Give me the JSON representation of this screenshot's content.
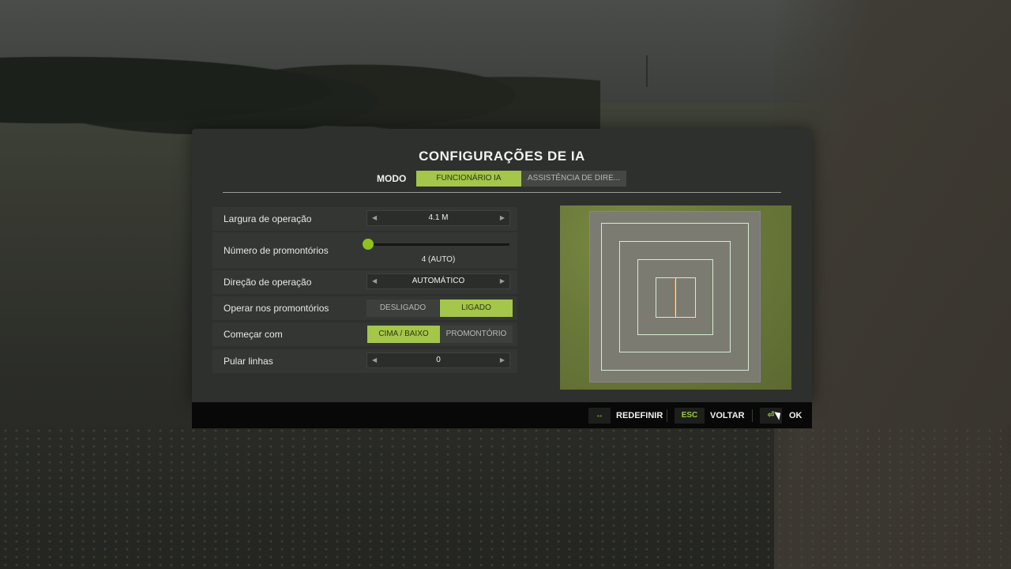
{
  "dialog": {
    "title": "CONFIGURAÇÕES DE IA",
    "mode_label": "MODO",
    "mode_tabs": [
      {
        "label": "FUNCIONÁRIO IA",
        "active": true
      },
      {
        "label": "ASSISTÊNCIA DE DIRE...",
        "active": false
      }
    ]
  },
  "settings": {
    "working_width": {
      "label": "Largura de operação",
      "value": "4.1 M"
    },
    "headlands": {
      "label": "Número de promontórios",
      "value": "4 (AUTO)"
    },
    "direction": {
      "label": "Direção de operação",
      "value": "AUTOMÁTICO"
    },
    "work_headlands": {
      "label": "Operar nos promontórios",
      "options": [
        "DESLIGADO",
        "LIGADO"
      ],
      "selected": "LIGADO"
    },
    "start_with": {
      "label": "Começar com",
      "options": [
        "CIMA / BAIXO",
        "PROMONTÓRIO"
      ],
      "selected": "CIMA / BAIXO"
    },
    "skip_lines": {
      "label": "Pular linhas",
      "value": "0"
    }
  },
  "footer": {
    "reset": {
      "key_icon": "reset-arrows-icon",
      "label": "REDEFINIR"
    },
    "back": {
      "key": "ESC",
      "label": "VOLTAR"
    },
    "ok": {
      "key_icon": "enter-icon",
      "label": "OK"
    }
  },
  "colors": {
    "accent": "#a4c64a",
    "slider_knob": "#8ec21c",
    "panel": "#2e302d"
  }
}
